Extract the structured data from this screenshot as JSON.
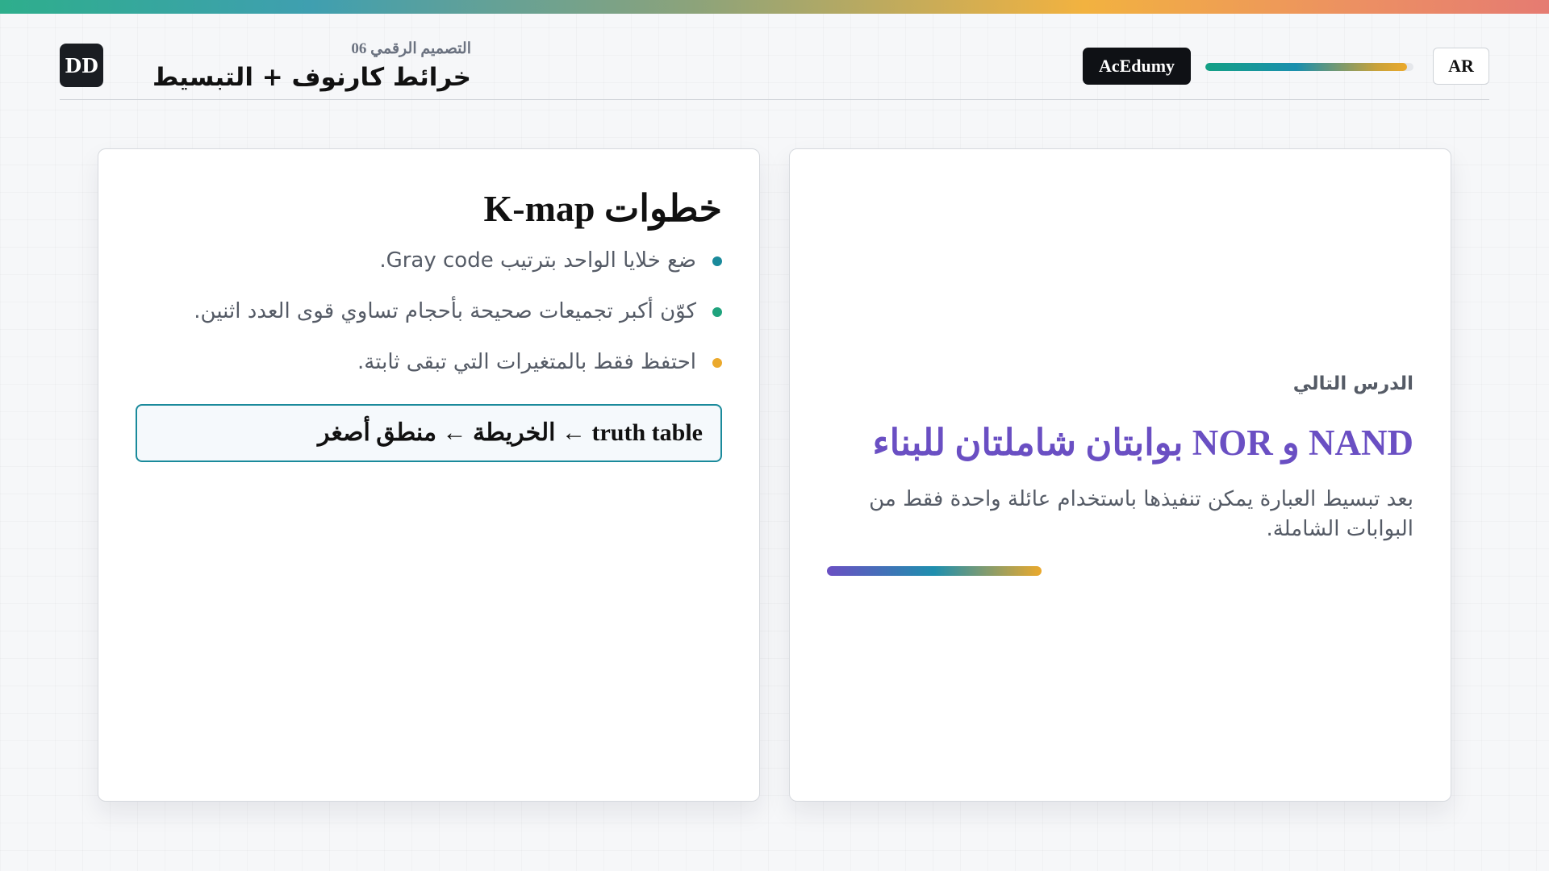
{
  "colors": {
    "accent_purple": "#6a4fc3",
    "accent_teal": "#1a8a9b",
    "dark_badge": "#0f1115",
    "step_dot_1": "#1a8a9b",
    "step_dot_2": "#1fa37d",
    "step_dot_3": "#eba92c"
  },
  "header": {
    "logo": "DD",
    "course_label": "التصميم الرقمي 06",
    "title": "خرائط كارنوف + التبسيط",
    "brand": "AcEdumy",
    "lang_button": "AR",
    "progress": 0.97
  },
  "kmap_card": {
    "title": "خطوات K-map",
    "steps": [
      "ضع خلايا الواحد بترتيب Gray code.",
      "كوّن أكبر تجميعات صحيحة بأحجام تساوي قوى العدد اثنين.",
      "احتفظ فقط بالمتغيرات التي تبقى ثابتة."
    ],
    "flow": "truth table ← الخريطة ← منطق أصغر"
  },
  "next_card": {
    "label": "الدرس التالي",
    "title": "NAND و NOR بوابتان شاملتان للبناء",
    "description": "بعد تبسيط العبارة يمكن تنفيذها باستخدام عائلة واحدة فقط من البوابات الشاملة."
  }
}
